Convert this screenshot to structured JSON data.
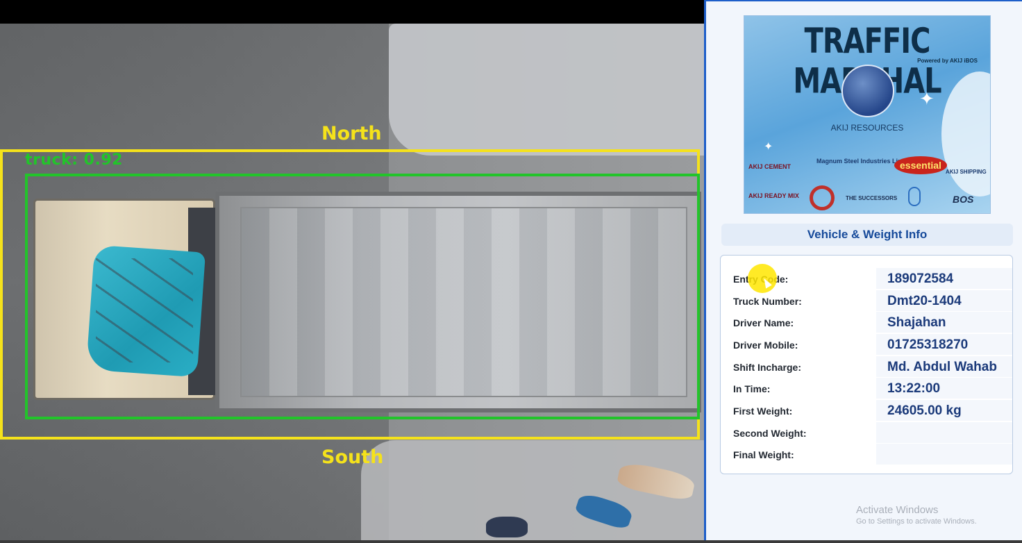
{
  "video": {
    "overlay": {
      "north_label": "North",
      "south_label": "South",
      "detection_label": "truck: 0.92"
    }
  },
  "banner": {
    "title": "TRAFFIC MARSHAL",
    "subtitle": "Powered by AKIJ iBOS",
    "resources": "AKIJ RESOURCES",
    "brands": {
      "cement": "AKIJ CEMENT",
      "magnum": "Magnum Steel Industries Limited",
      "essential": "essential",
      "shipping": "AKIJ SHIPPING",
      "ready_mix": "AKIJ READY MIX",
      "successors": "THE SUCCESSORS",
      "bos": "BOS"
    }
  },
  "info": {
    "section_title": "Vehicle & Weight Info",
    "rows": [
      {
        "label": "Entry Code:",
        "value": "189072584"
      },
      {
        "label": "Truck Number:",
        "value": "Dmt20-1404"
      },
      {
        "label": "Driver Name:",
        "value": "Shajahan"
      },
      {
        "label": "Driver Mobile:",
        "value": "01725318270"
      },
      {
        "label": "Shift Incharge:",
        "value": "Md. Abdul Wahab"
      },
      {
        "label": "In Time:",
        "value": "13:22:00"
      },
      {
        "label": "First Weight:",
        "value": "24605.00 kg"
      },
      {
        "label": "Second Weight:",
        "value": ""
      },
      {
        "label": "Final Weight:",
        "value": ""
      }
    ]
  },
  "watermark": {
    "title": "Activate Windows",
    "subtitle": "Go to Settings to activate Windows."
  },
  "colors": {
    "zone_box": "#f5e21b",
    "detection_box": "#22c42a",
    "accent": "#1d5ec9",
    "value_text": "#1b3a7a"
  }
}
